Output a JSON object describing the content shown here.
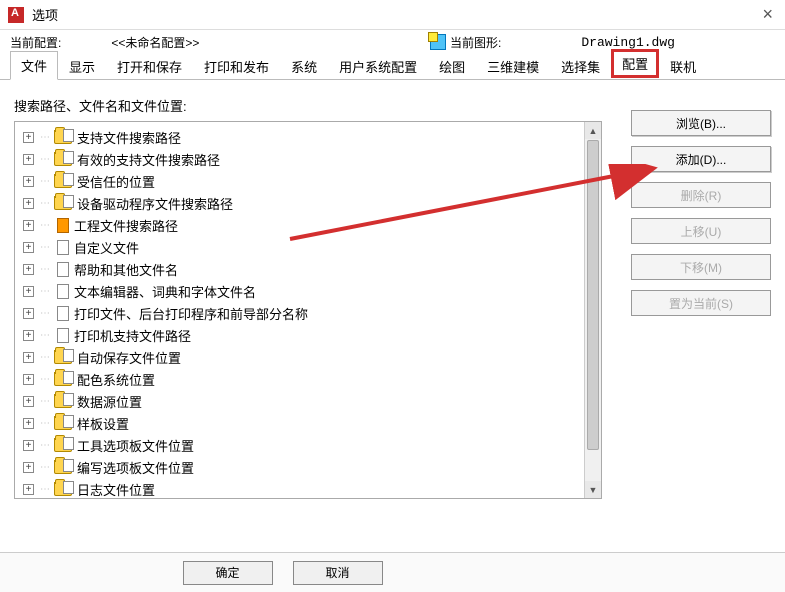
{
  "window": {
    "title": "选项"
  },
  "info": {
    "current_profile_label": "当前配置:",
    "current_profile_value": "<<未命名配置>>",
    "current_drawing_label": "当前图形:",
    "current_drawing_value": "Drawing1.dwg"
  },
  "tabs": {
    "items": [
      {
        "label": "文件",
        "active": true
      },
      {
        "label": "显示"
      },
      {
        "label": "打开和保存"
      },
      {
        "label": "打印和发布"
      },
      {
        "label": "系统"
      },
      {
        "label": "用户系统配置"
      },
      {
        "label": "绘图"
      },
      {
        "label": "三维建模"
      },
      {
        "label": "选择集"
      },
      {
        "label": "配置",
        "highlight": true
      },
      {
        "label": "联机"
      }
    ]
  },
  "section_label": "搜索路径、文件名和文件位置:",
  "tree": [
    {
      "icon": "folder-sheet",
      "label": "支持文件搜索路径"
    },
    {
      "icon": "folder-sheet",
      "label": "有效的支持文件搜索路径"
    },
    {
      "icon": "folder-sheet",
      "label": "受信任的位置"
    },
    {
      "icon": "folder-sheet",
      "label": "设备驱动程序文件搜索路径"
    },
    {
      "icon": "doc-orange",
      "label": "工程文件搜索路径"
    },
    {
      "icon": "doc",
      "label": "自定义文件"
    },
    {
      "icon": "doc",
      "label": "帮助和其他文件名"
    },
    {
      "icon": "doc",
      "label": "文本编辑器、词典和字体文件名"
    },
    {
      "icon": "doc",
      "label": "打印文件、后台打印程序和前导部分名称"
    },
    {
      "icon": "doc",
      "label": "打印机支持文件路径"
    },
    {
      "icon": "folder-sheet",
      "label": "自动保存文件位置"
    },
    {
      "icon": "folder-sheet",
      "label": "配色系统位置"
    },
    {
      "icon": "folder-sheet",
      "label": "数据源位置"
    },
    {
      "icon": "folder-sheet",
      "label": "样板设置"
    },
    {
      "icon": "folder-sheet",
      "label": "工具选项板文件位置"
    },
    {
      "icon": "folder-sheet",
      "label": "编写选项板文件位置"
    },
    {
      "icon": "folder-sheet",
      "label": "日志文件位置"
    }
  ],
  "side_buttons": {
    "browse": "浏览(B)...",
    "add": "添加(D)...",
    "delete": "删除(R)",
    "move_up": "上移(U)",
    "move_down": "下移(M)",
    "set_current": "置为当前(S)"
  },
  "footer": {
    "ok": "确定",
    "cancel": "取消"
  }
}
